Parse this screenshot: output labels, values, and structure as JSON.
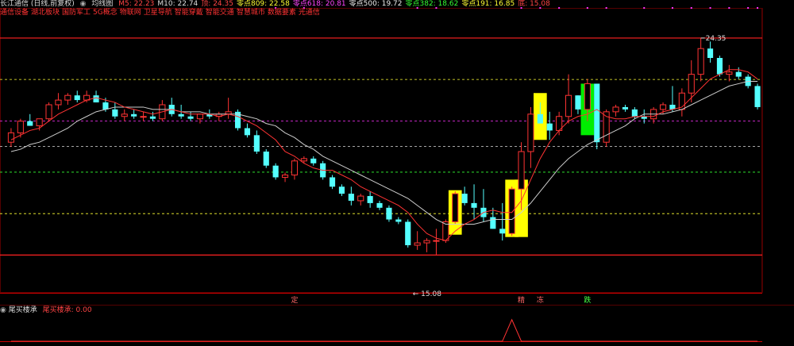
{
  "header": {
    "title": "长江通信 (日线,前复权)",
    "indicator_title": "均线图",
    "ma": [
      {
        "label": "M5: 22.23",
        "color": "#ff4444"
      },
      {
        "label": "M10: 22.74",
        "color": "#dddddd"
      },
      {
        "label": "顶: 24.35",
        "color": "#ff4444"
      },
      {
        "label": "零点809: 22.58",
        "color": "#ffff33"
      },
      {
        "label": "零点618: 20.81",
        "color": "#ff44ff"
      },
      {
        "label": "零点500: 19.72",
        "color": "#eeeeee"
      },
      {
        "label": "零点382: 18.62",
        "color": "#33ff33"
      },
      {
        "label": "零点191: 16.85",
        "color": "#ffff33"
      },
      {
        "label": "底: 15.08",
        "color": "#ff4444"
      }
    ]
  },
  "tags": [
    "通信设备",
    "湖北板块",
    "国防军工",
    "5G概念",
    "物联网",
    "卫星导航",
    "智能穿戴",
    "智能交通",
    "智慧城市",
    "数据要素",
    "光通信"
  ],
  "main_chart": {
    "high_label": "24.35",
    "low_label": "← 15.08",
    "signal_labels": [
      {
        "text": "定",
        "index": 30,
        "color": "#ff6666"
      },
      {
        "text": "精",
        "index": 54,
        "color": "#ff6666"
      },
      {
        "text": "冻",
        "index": 56,
        "color": "#ff6666"
      },
      {
        "text": "跌",
        "index": 61,
        "color": "#44ff44"
      }
    ]
  },
  "sub_chart": {
    "title": "尾买楼承",
    "value_label": "尾买楼承: 0.00"
  },
  "chart_data": {
    "type": "candlestick",
    "ylim": [
      13.5,
      25.5
    ],
    "levels": [
      {
        "name": "顶",
        "value": 24.35,
        "color": "#ff2222",
        "style": "solid"
      },
      {
        "name": "零点809",
        "value": 22.58,
        "color": "#ffff33",
        "style": "dashed"
      },
      {
        "name": "零点618",
        "value": 20.81,
        "color": "#ff33ff",
        "style": "dashed"
      },
      {
        "name": "零点500",
        "value": 19.72,
        "color": "#dddddd",
        "style": "dashed"
      },
      {
        "name": "零点382",
        "value": 18.62,
        "color": "#33ff33",
        "style": "dashed"
      },
      {
        "name": "零点191",
        "value": 16.85,
        "color": "#ffff33",
        "style": "dashed"
      },
      {
        "name": "底",
        "value": 15.08,
        "color": "#ff2222",
        "style": "solid"
      }
    ],
    "candles": [
      [
        19.9,
        20.5,
        19.7,
        20.3
      ],
      [
        20.3,
        20.9,
        20.1,
        20.8
      ],
      [
        20.8,
        21.1,
        20.6,
        20.6
      ],
      [
        20.6,
        20.9,
        20.4,
        20.9
      ],
      [
        20.9,
        21.6,
        20.8,
        21.5
      ],
      [
        21.5,
        22.0,
        21.3,
        21.7
      ],
      [
        21.7,
        22.0,
        21.5,
        21.9
      ],
      [
        21.9,
        22.1,
        21.6,
        21.7
      ],
      [
        21.7,
        22.1,
        21.6,
        21.9
      ],
      [
        21.9,
        22.1,
        21.6,
        21.6
      ],
      [
        21.6,
        21.8,
        21.2,
        21.3
      ],
      [
        21.3,
        21.6,
        20.9,
        21.0
      ],
      [
        21.0,
        21.3,
        20.8,
        21.1
      ],
      [
        21.1,
        21.3,
        20.9,
        21.0
      ],
      [
        21.0,
        21.2,
        20.8,
        21.0
      ],
      [
        21.0,
        21.2,
        20.8,
        20.9
      ],
      [
        20.9,
        21.7,
        20.8,
        21.5
      ],
      [
        21.5,
        21.8,
        21.0,
        21.1
      ],
      [
        21.1,
        21.5,
        20.9,
        21.0
      ],
      [
        21.0,
        21.2,
        20.8,
        20.9
      ],
      [
        20.9,
        21.1,
        20.7,
        21.1
      ],
      [
        21.1,
        21.3,
        20.9,
        21.0
      ],
      [
        21.0,
        21.2,
        20.8,
        21.1
      ],
      [
        21.1,
        21.8,
        20.9,
        21.2
      ],
      [
        21.2,
        21.3,
        20.4,
        20.5
      ],
      [
        20.5,
        20.7,
        20.1,
        20.2
      ],
      [
        20.2,
        20.4,
        19.4,
        19.5
      ],
      [
        19.5,
        19.6,
        18.8,
        18.9
      ],
      [
        18.9,
        19.0,
        18.3,
        18.4
      ],
      [
        18.4,
        18.6,
        18.2,
        18.5
      ],
      [
        18.5,
        19.2,
        18.3,
        19.1
      ],
      [
        19.1,
        19.3,
        19.0,
        19.2
      ],
      [
        19.2,
        19.3,
        18.9,
        19.0
      ],
      [
        19.0,
        19.1,
        18.3,
        18.4
      ],
      [
        18.4,
        18.5,
        17.9,
        18.0
      ],
      [
        18.0,
        18.1,
        17.6,
        17.7
      ],
      [
        17.7,
        18.0,
        17.2,
        17.4
      ],
      [
        17.4,
        17.7,
        17.2,
        17.6
      ],
      [
        17.6,
        17.8,
        17.1,
        17.3
      ],
      [
        17.3,
        17.4,
        17.0,
        17.1
      ],
      [
        17.1,
        17.2,
        16.5,
        16.6
      ],
      [
        16.6,
        16.7,
        16.4,
        16.5
      ],
      [
        16.5,
        16.6,
        15.4,
        15.5
      ],
      [
        15.5,
        16.1,
        15.3,
        15.6
      ],
      [
        15.6,
        15.8,
        15.2,
        15.7
      ],
      [
        15.7,
        16.2,
        15.1,
        15.7
      ],
      [
        15.7,
        16.6,
        15.6,
        16.5
      ],
      [
        16.5,
        17.8,
        16.4,
        17.7
      ],
      [
        17.7,
        18.0,
        17.2,
        17.3
      ],
      [
        17.3,
        18.1,
        16.6,
        17.1
      ],
      [
        17.1,
        17.9,
        16.5,
        16.7
      ],
      [
        16.7,
        17.1,
        16.2,
        16.2
      ],
      [
        16.2,
        17.3,
        15.7,
        16.0
      ],
      [
        16.0,
        18.0,
        15.9,
        17.9
      ],
      [
        17.9,
        19.9,
        17.0,
        19.5
      ],
      [
        19.5,
        21.4,
        18.8,
        21.1
      ],
      [
        21.1,
        21.6,
        20.8,
        20.7
      ],
      [
        20.7,
        21.2,
        20.0,
        20.4
      ],
      [
        20.4,
        21.2,
        20.2,
        21.0
      ],
      [
        21.0,
        22.8,
        20.7,
        21.9
      ],
      [
        21.9,
        21.9,
        21.1,
        21.3
      ],
      [
        21.3,
        22.6,
        20.8,
        22.4
      ],
      [
        22.4,
        22.4,
        19.6,
        19.9
      ],
      [
        19.9,
        21.3,
        19.7,
        21.2
      ],
      [
        21.2,
        21.5,
        21.0,
        21.4
      ],
      [
        21.4,
        21.5,
        21.2,
        21.3
      ],
      [
        21.3,
        21.4,
        20.9,
        21.0
      ],
      [
        21.0,
        21.3,
        20.7,
        20.9
      ],
      [
        20.9,
        21.4,
        20.7,
        21.3
      ],
      [
        21.3,
        21.6,
        21.1,
        21.5
      ],
      [
        21.5,
        22.3,
        21.2,
        21.3
      ],
      [
        21.3,
        22.2,
        21.0,
        22.0
      ],
      [
        22.0,
        23.4,
        21.6,
        22.8
      ],
      [
        22.8,
        24.35,
        22.5,
        23.9
      ],
      [
        23.9,
        24.2,
        23.3,
        23.5
      ],
      [
        23.5,
        23.6,
        22.7,
        22.8
      ],
      [
        22.8,
        23.2,
        22.5,
        22.9
      ],
      [
        22.9,
        23.1,
        22.6,
        22.7
      ],
      [
        22.7,
        22.8,
        22.2,
        22.3
      ],
      [
        22.3,
        22.4,
        21.3,
        21.4
      ]
    ],
    "ma5": [
      20.0,
      20.2,
      20.4,
      20.5,
      20.8,
      21.1,
      21.3,
      21.5,
      21.7,
      21.8,
      21.7,
      21.6,
      21.4,
      21.3,
      21.2,
      21.1,
      21.2,
      21.3,
      21.2,
      21.1,
      21.1,
      21.1,
      21.0,
      21.1,
      21.0,
      20.8,
      20.6,
      20.3,
      20.0,
      19.5,
      19.3,
      19.0,
      18.8,
      18.7,
      18.7,
      18.5,
      18.3,
      18.0,
      17.8,
      17.6,
      17.4,
      17.2,
      16.9,
      16.4,
      16.0,
      15.8,
      15.7,
      16.1,
      16.4,
      16.6,
      16.9,
      17.0,
      16.9,
      16.9,
      17.4,
      18.3,
      19.2,
      19.9,
      20.4,
      20.8,
      21.0,
      21.1,
      21.3,
      21.0,
      20.9,
      20.9,
      21.0,
      21.0,
      21.0,
      21.2,
      21.3,
      21.4,
      21.8,
      22.2,
      22.6,
      22.8,
      23.0,
      23.0,
      22.9,
      22.6
    ],
    "ma10": [
      19.5,
      19.6,
      19.8,
      19.9,
      20.1,
      20.3,
      20.5,
      20.8,
      21.0,
      21.2,
      21.3,
      21.4,
      21.4,
      21.4,
      21.4,
      21.3,
      21.3,
      21.3,
      21.2,
      21.2,
      21.2,
      21.1,
      21.1,
      21.1,
      21.1,
      21.0,
      20.9,
      20.7,
      20.6,
      20.3,
      20.1,
      19.8,
      19.6,
      19.3,
      19.1,
      18.9,
      18.7,
      18.5,
      18.3,
      18.1,
      17.9,
      17.7,
      17.5,
      17.2,
      16.9,
      16.6,
      16.4,
      16.4,
      16.4,
      16.4,
      16.5,
      16.6,
      16.6,
      16.6,
      16.9,
      17.3,
      17.8,
      18.3,
      18.8,
      19.2,
      19.5,
      19.8,
      20.0,
      20.2,
      20.4,
      20.6,
      20.9,
      21.1,
      21.1,
      21.1,
      21.2,
      21.3,
      21.5,
      21.7,
      21.9,
      22.1,
      22.3,
      22.4,
      22.5,
      22.5
    ],
    "highlight_bars": [
      {
        "index": 47,
        "low": 15.95,
        "high": 17.85,
        "color": "#ffff00"
      },
      {
        "index": 53,
        "low": 15.85,
        "high": 18.3,
        "color": "#ffff00"
      },
      {
        "index": 54,
        "low": 15.85,
        "high": 18.3,
        "color": "#ffff00"
      },
      {
        "index": 56,
        "low": 20.0,
        "high": 22.0,
        "color": "#ffff00"
      },
      {
        "index": 61,
        "low": 20.2,
        "high": 22.4,
        "color": "#00ee00"
      }
    ],
    "sub_series": {
      "ylim": [
        0,
        1
      ],
      "values": [
        0,
        0,
        0,
        0,
        0,
        0,
        0,
        0,
        0,
        0,
        0,
        0,
        0,
        0,
        0,
        0,
        0,
        0,
        0,
        0,
        0,
        0,
        0,
        0,
        0,
        0,
        0,
        0,
        0,
        0,
        0,
        0,
        0,
        0,
        0,
        0,
        0,
        0,
        0,
        0,
        0,
        0,
        0,
        0,
        0,
        0,
        0,
        0,
        0,
        0,
        0,
        0,
        0,
        0.85,
        0,
        0,
        0,
        0,
        0,
        0,
        0,
        0,
        0,
        0,
        0,
        0,
        0,
        0,
        0,
        0,
        0,
        0,
        0,
        0,
        0,
        0,
        0,
        0,
        0,
        0
      ]
    },
    "top_markers": [
      28,
      31,
      43,
      45,
      54,
      56,
      58,
      61,
      63,
      67,
      70,
      72,
      74,
      76,
      78,
      79
    ]
  }
}
